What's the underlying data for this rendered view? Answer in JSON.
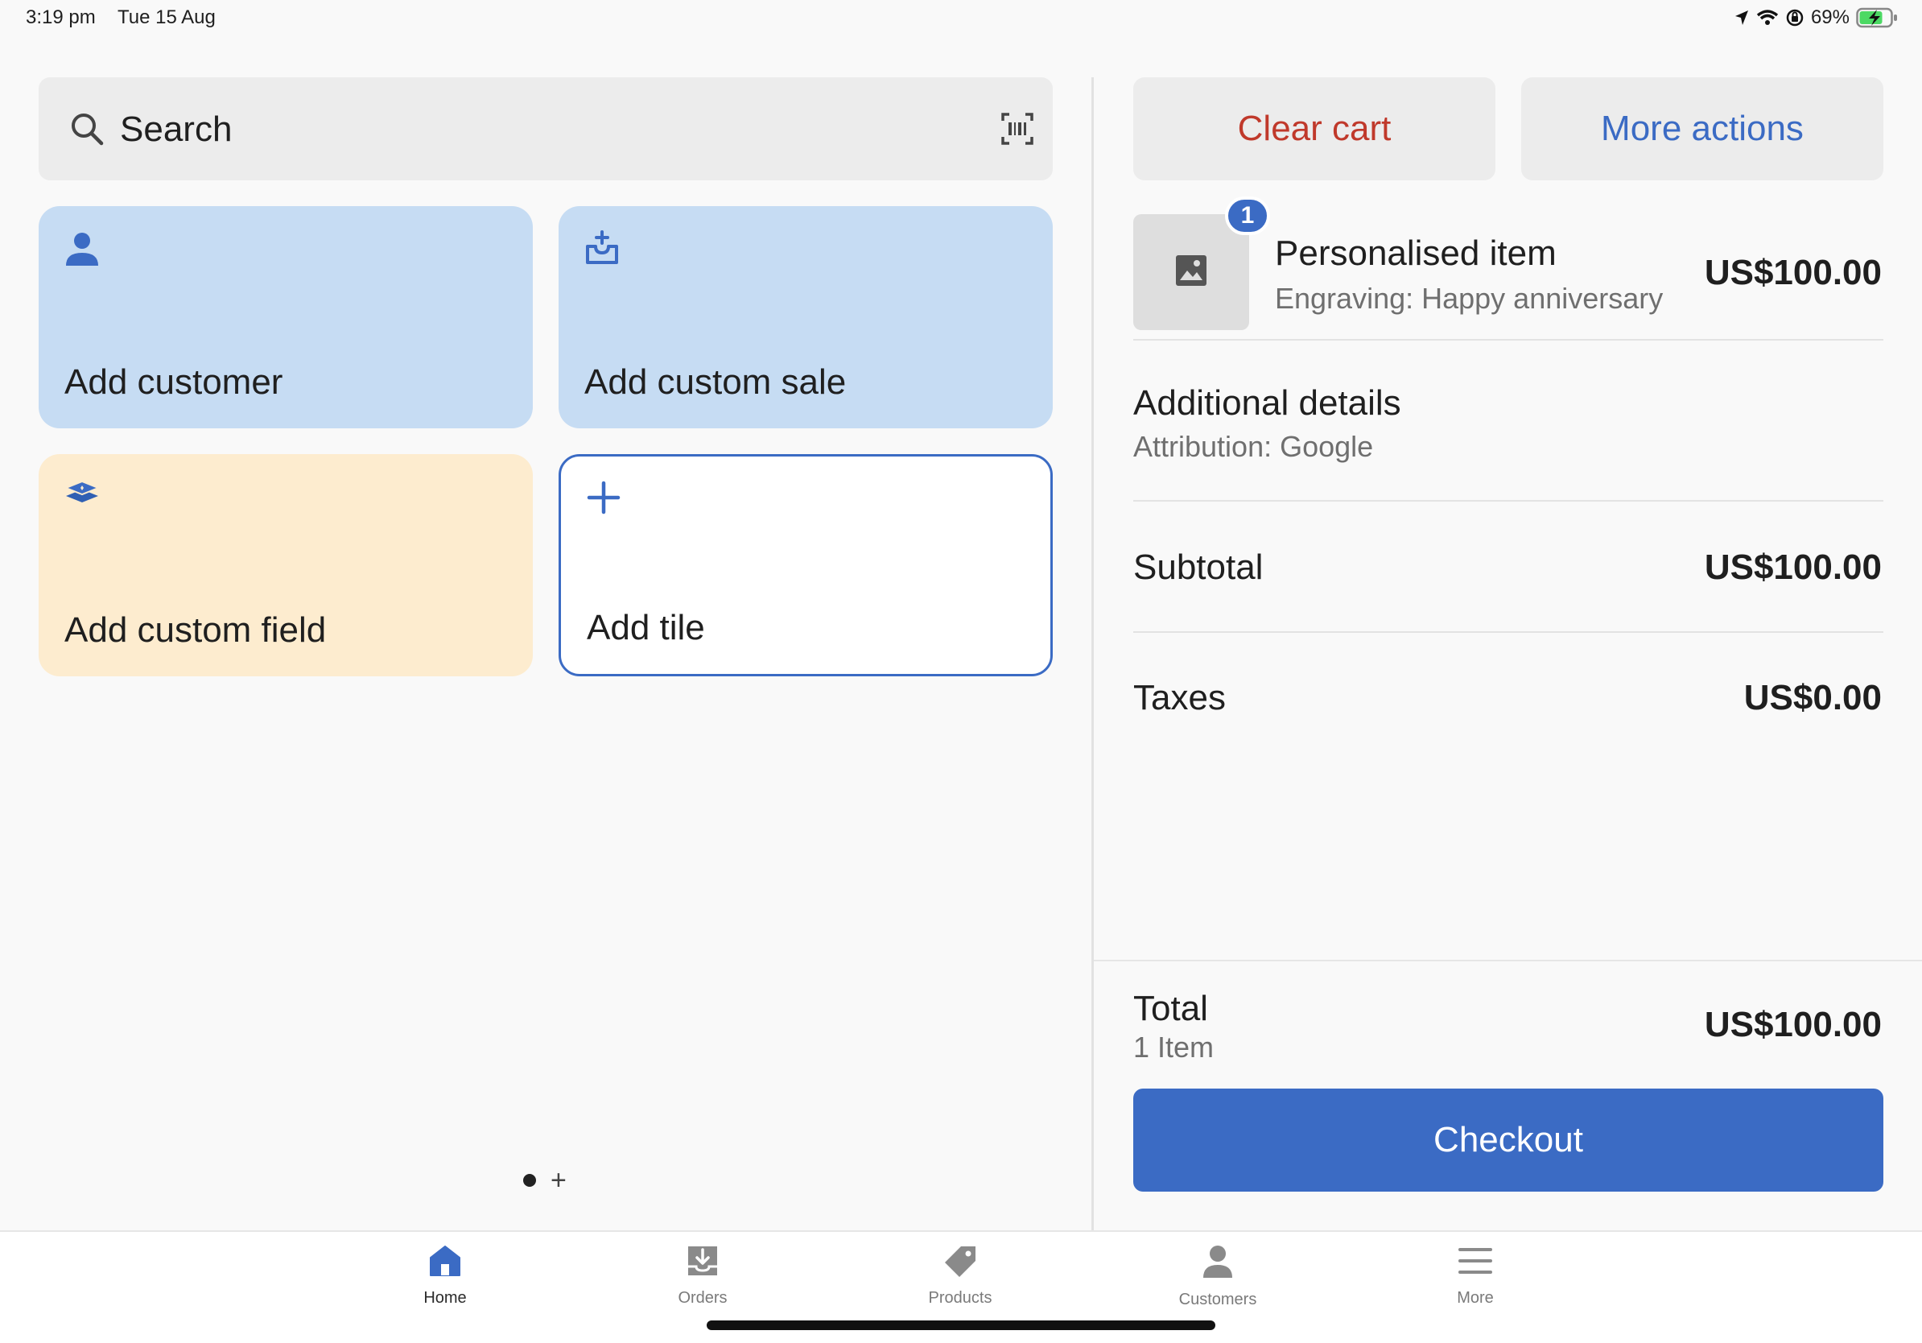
{
  "status_bar": {
    "time": "3:19 pm",
    "date": "Tue 15 Aug",
    "battery": "69%",
    "icons": [
      "location-icon",
      "wifi-icon",
      "orientation-lock-icon",
      "battery-charging-icon"
    ]
  },
  "search": {
    "label": "Search",
    "icons": [
      "search-icon",
      "barcode-scan-icon"
    ]
  },
  "tiles": [
    {
      "label": "Add customer",
      "icon": "person-icon",
      "color": "#c6dcf3"
    },
    {
      "label": "Add custom sale",
      "icon": "custom-sale-icon",
      "color": "#c6dcf3"
    },
    {
      "label": "Add custom field",
      "icon": "layers-icon",
      "color": "#fdeccf"
    },
    {
      "label": "Add tile",
      "icon": "plus-icon",
      "color": "#ffffff"
    }
  ],
  "pager": {
    "add_page": "+"
  },
  "cart": {
    "clear_label": "Clear cart",
    "more_label": "More actions",
    "item": {
      "quantity": "1",
      "name": "Personalised item",
      "note": "Engraving: Happy anniversary",
      "price": "US$100.00",
      "thumb_icon": "image-placeholder-icon"
    },
    "additional_details": {
      "title": "Additional details",
      "subtitle": "Attribution: Google"
    },
    "subtotal_label": "Subtotal",
    "subtotal_value": "US$100.00",
    "taxes_label": "Taxes",
    "taxes_value": "US$0.00",
    "total_label": "Total",
    "total_items": "1 Item",
    "total_value": "US$100.00",
    "checkout_label": "Checkout"
  },
  "tabs": [
    {
      "label": "Home",
      "icon": "home-icon",
      "active": true
    },
    {
      "label": "Orders",
      "icon": "orders-icon",
      "active": false
    },
    {
      "label": "Products",
      "icon": "tag-icon",
      "active": false
    },
    {
      "label": "Customers",
      "icon": "person-icon",
      "active": false
    },
    {
      "label": "More",
      "icon": "menu-icon",
      "active": false
    }
  ],
  "colors": {
    "accent": "#3b6bc4",
    "destructive": "#c0392b",
    "tile_blue": "#c6dcf3",
    "tile_yellow": "#fdeccf"
  }
}
